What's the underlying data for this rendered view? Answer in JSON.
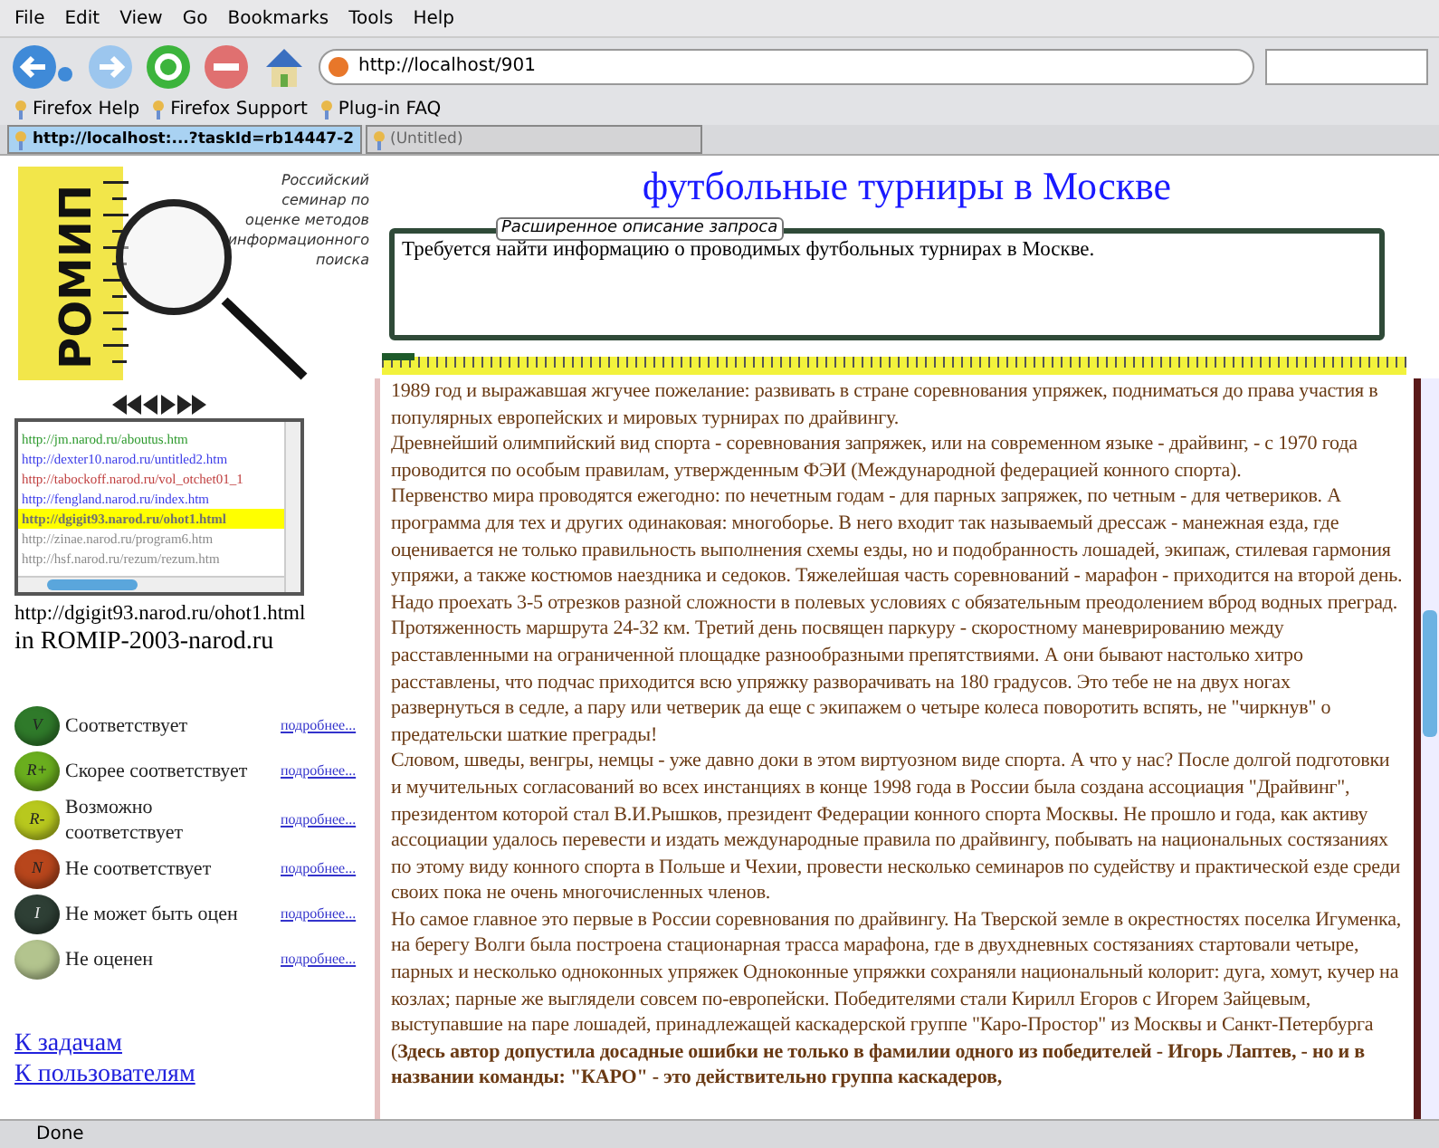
{
  "browser": {
    "menu": [
      "File",
      "Edit",
      "View",
      "Go",
      "Bookmarks",
      "Tools",
      "Help"
    ],
    "url": "http://localhost/901",
    "bookmarks": [
      "Firefox Help",
      "Firefox Support",
      "Plug-in FAQ"
    ],
    "tabs": [
      {
        "label": "http://localhost:...?taskId=rb14447-2",
        "selected": true
      },
      {
        "label": "(Untitled)",
        "selected": false
      }
    ],
    "status": "Done"
  },
  "sidebar": {
    "logo": {
      "name": "РОМИП",
      "tagline": [
        "Российский",
        "семинар по",
        "оценке методов",
        "информационного",
        "поиска"
      ]
    },
    "docs": [
      {
        "url": "http://jm.narod.ru/aboutus.htm",
        "color": "#2e9a2e",
        "selected": false
      },
      {
        "url": "http://dexter10.narod.ru/untitled2.htm",
        "color": "#3a3ae8",
        "selected": false
      },
      {
        "url": "http://tabockoff.narod.ru/vol_otchet01_1",
        "color": "#c04040",
        "selected": false
      },
      {
        "url": "http://fengland.narod.ru/index.htm",
        "color": "#3a3ae8",
        "selected": false
      },
      {
        "url": "http://dgigit93.narod.ru/ohot1.html",
        "color": "#707070",
        "selected": true
      },
      {
        "url": "http://zinae.narod.ru/program6.htm",
        "color": "#8a8a8a",
        "selected": false
      },
      {
        "url": "http://hsf.narod.ru/rezum/rezum.htm",
        "color": "#8a8a8a",
        "selected": false
      }
    ],
    "current_url": "http://dgigit93.narod.ru/ohot1.html",
    "collection": "in ROMIP-2003-narod.ru",
    "ratings": [
      {
        "glyph": "V",
        "label": "Соответствует",
        "color": "#2f7a2a",
        "link": "подробнее..."
      },
      {
        "glyph": "R+",
        "label": "Скорее соответствует",
        "color": "#6aae1e",
        "link": "подробнее..."
      },
      {
        "glyph": "R-",
        "label": "Возможно соответствует",
        "color": "#b8c81e",
        "link": "подробнее..."
      },
      {
        "glyph": "N",
        "label": "Не соответствует",
        "color": "#b8461c",
        "link": "подробнее..."
      },
      {
        "glyph": "I",
        "label": "Не может быть оцен",
        "color": "#2e3f35",
        "link": "подробнее..."
      },
      {
        "label": "Не оценен",
        "color": "#b3c48e",
        "link": "подробнее..."
      }
    ],
    "links": [
      "К задачам",
      "К пользователям"
    ]
  },
  "main": {
    "title": "футбольные турниры в Москве",
    "query_legend": "Расширенное описание запроса",
    "query_text": "Требуется найти информацию о проводимых футбольных турнирах в Москве.",
    "paragraphs": [
      "1989 год и выражавшая жгучее пожелание: развивать в стране соревнования упряжек, подниматься до права участия в популярных европейских и мировых турнирах по драйвингу.",
      "Древнейший олимпийский вид спорта - соревнования запряжек, или на современном языке - драйвинг, - с 1970 года проводится по особым правилам, утвержденным ФЭИ (Международной федерацией конного спорта).",
      "Первенство мира проводятся ежегодно: по нечетным годам - для парных запряжек, по четным - для четвериков. А программа для тех и других одинаковая: многоборье. В него входит так называемый дрессаж - манежная езда, где оценивается не только правильность выполнения схемы езды, но и подобранность лошадей, экипаж, стилевая гармония упряжи, а также костюмов наездника и седоков. Тяжелейшая часть соревнований - марафон - приходится на второй день. Надо проехать 3-5 отрезков разной сложности в полевых условиях с обязательным преодолением вброд водных преград. Протяженность маршрута 24-32 км. Третий день посвящен паркуру - скоростному маневрированию между расставленными на ограниченной площадке разнообразными препятствиями. А они бывают настолько хитро расставлены, что подчас приходится всю упряжку разворачивать на 180 градусов. Это тебе не на двух ногах развернуться в седле, а пару или четверик да еще с экипажем о четыре колеса поворотить вспять, не \"чиркнув\" о предательски шаткие преграды!",
      "Словом, шведы, венгры, немцы - уже давно доки в этом виртуозном виде спорта. А что у нас? После долгой подготовки и мучительных согласований во всех инстанциях в конце 1998 года в России была создана ассоциация \"Драйвинг\", президентом которой стал В.И.Рышков, президент Федерации конного спорта Москвы. Не прошло и года, как активу ассоциации удалось перевести и издать международные правила по драйвингу, побывать на национальных состязаниях по этому виду конного спорта в Польше и Чехии, провести несколько семинаров по судейству и практической езде среди своих пока не очень многочисленных членов.",
      "Но самое главное это первые в России соревнования по драйвингу. На Тверской земле в окрестностях поселка Игуменка, на берегу Волги была построена стационарная трасса марафона, где в двухдневных состязаниях стартовали четыре, парных и несколько одноконных упряжек Одноконные упряжки сохраняли национальный колорит: дуга, хомут, кучер на козлах; парные же выглядели совсем по-европейски. Победителями стали Кирилл Егоров с Игорем Зайцевым, выступавшие на паре лошадей, принадлежащей каскадерской группе \"Каро-Простор\" из Москвы и Санкт-Петербурга (**Здесь автор допустила досадные ошибки не только в фамилии одного из победителей - Игорь Лаптев, - но и в названии команды: \"КАРО\" - это действительно группа каскадеров,**"
    ]
  }
}
